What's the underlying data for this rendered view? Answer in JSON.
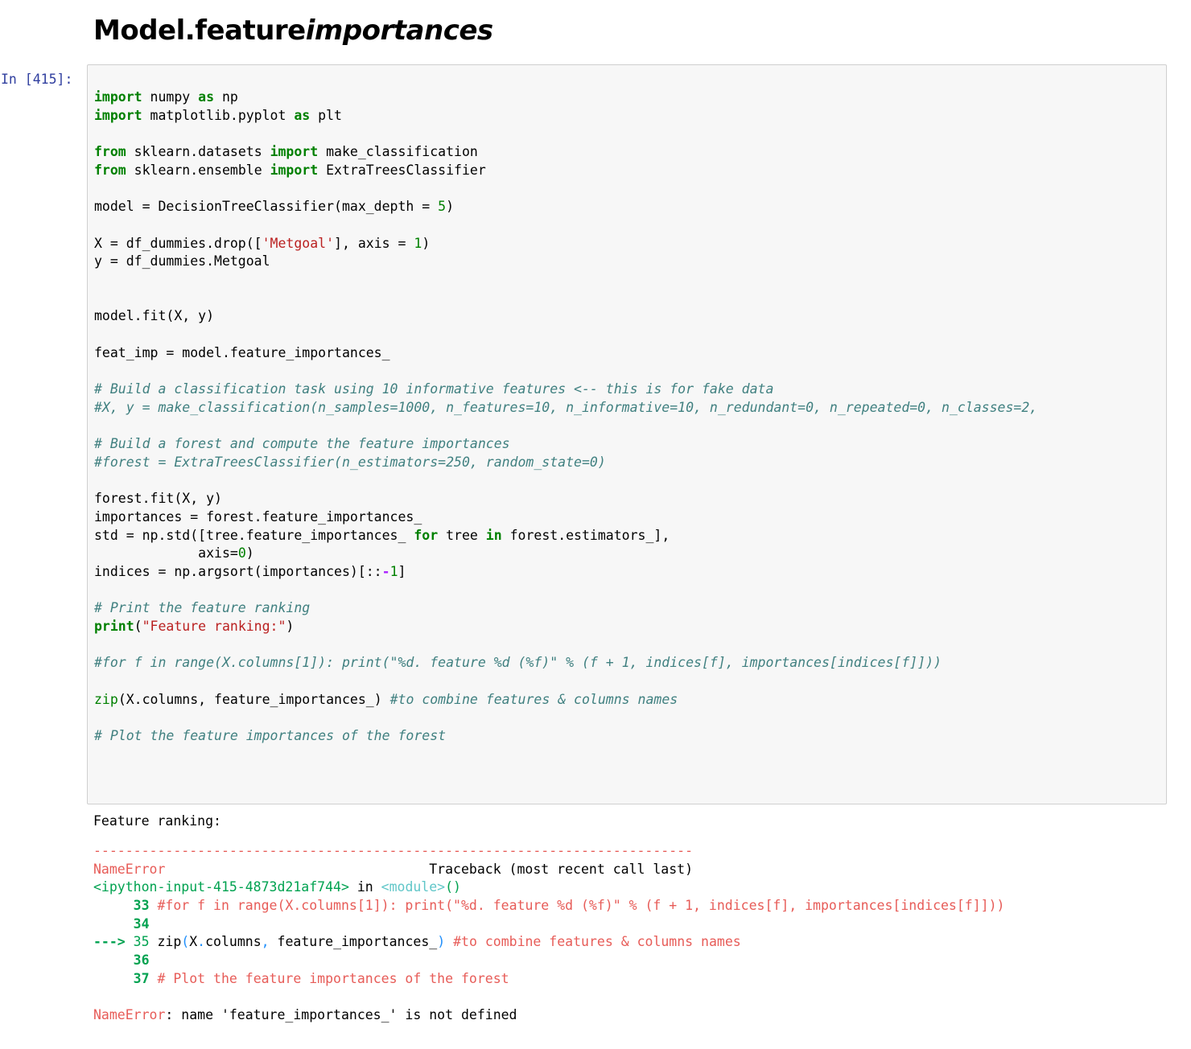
{
  "heading": {
    "prefix": "Model.feature",
    "italic": "importances"
  },
  "cell": {
    "prompt": "In [415]:",
    "code_lines": [
      [
        [
          "kw",
          "import"
        ],
        [
          "t",
          " numpy "
        ],
        [
          "kw",
          "as"
        ],
        [
          "t",
          " np"
        ]
      ],
      [
        [
          "kw",
          "import"
        ],
        [
          "t",
          " matplotlib.pyplot "
        ],
        [
          "kw",
          "as"
        ],
        [
          "t",
          " plt"
        ]
      ],
      [],
      [
        [
          "kw",
          "from"
        ],
        [
          "t",
          " sklearn.datasets "
        ],
        [
          "kw",
          "import"
        ],
        [
          "t",
          " make_classification"
        ]
      ],
      [
        [
          "kw",
          "from"
        ],
        [
          "t",
          " sklearn.ensemble "
        ],
        [
          "kw",
          "import"
        ],
        [
          "t",
          " ExtraTreesClassifier"
        ]
      ],
      [],
      [
        [
          "t",
          "model = DecisionTreeClassifier(max_depth = "
        ],
        [
          "num",
          "5"
        ],
        [
          "t",
          ")"
        ]
      ],
      [],
      [
        [
          "t",
          "X = df_dummies.drop(["
        ],
        [
          "str",
          "'Metgoal'"
        ],
        [
          "t",
          "], axis = "
        ],
        [
          "num",
          "1"
        ],
        [
          "t",
          ")"
        ]
      ],
      [
        [
          "t",
          "y = df_dummies.Metgoal"
        ]
      ],
      [],
      [],
      [
        [
          "t",
          "model.fit(X, y)"
        ]
      ],
      [],
      [
        [
          "t",
          "feat_imp = model.feature_importances_"
        ]
      ],
      [],
      [
        [
          "cm",
          "# Build a classification task using 10 informative features <-- this is for fake data"
        ]
      ],
      [
        [
          "cm",
          "#X, y = make_classification(n_samples=1000, n_features=10, n_informative=10, n_redundant=0, n_repeated=0, n_classes=2,"
        ]
      ],
      [],
      [
        [
          "cm",
          "# Build a forest and compute the feature importances"
        ]
      ],
      [
        [
          "cm",
          "#forest = ExtraTreesClassifier(n_estimators=250, random_state=0)"
        ]
      ],
      [],
      [
        [
          "t",
          "forest.fit(X, y)"
        ]
      ],
      [
        [
          "t",
          "importances = forest.feature_importances_"
        ]
      ],
      [
        [
          "t",
          "std = np.std([tree.feature_importances_ "
        ],
        [
          "kw",
          "for"
        ],
        [
          "t",
          " tree "
        ],
        [
          "kw",
          "in"
        ],
        [
          "t",
          " forest.estimators_],"
        ]
      ],
      [
        [
          "t",
          "             axis="
        ],
        [
          "num",
          "0"
        ],
        [
          "t",
          ")"
        ]
      ],
      [
        [
          "t",
          "indices = np.argsort(importances)[::"
        ],
        [
          "op",
          "-"
        ],
        [
          "num",
          "1"
        ],
        [
          "t",
          "]"
        ]
      ],
      [],
      [
        [
          "cm",
          "# Print the feature ranking"
        ]
      ],
      [
        [
          "kw",
          "print"
        ],
        [
          "t",
          "("
        ],
        [
          "str",
          "\"Feature ranking:\""
        ],
        [
          "t",
          ")"
        ]
      ],
      [],
      [
        [
          "cm",
          "#for f in range(X.columns[1]): print(\"%d. feature %d (%f)\" % (f + 1, indices[f], importances[indices[f]]))"
        ]
      ],
      [],
      [
        [
          "bi",
          "zip"
        ],
        [
          "t",
          "(X.columns, feature_importances_) "
        ],
        [
          "cm",
          "#to combine features & columns names"
        ]
      ],
      [],
      [
        [
          "cm",
          "# Plot the feature importances of the forest"
        ]
      ]
    ]
  },
  "output": {
    "stream": "Feature ranking:",
    "error_lines": [
      [
        [
          "er",
          "---------------------------------------------------------------------------"
        ]
      ],
      [
        [
          "er",
          "NameError"
        ],
        [
          "t",
          "                                 Traceback (most recent call last)"
        ]
      ],
      [
        [
          "eg",
          "<ipython-input-415-4873d21af744>"
        ],
        [
          "t",
          " in "
        ],
        [
          "ecy",
          "<module>"
        ],
        [
          "eg",
          "()"
        ]
      ],
      [
        [
          "t",
          "     "
        ],
        [
          "egb",
          "33"
        ],
        [
          "t",
          " "
        ],
        [
          "er",
          "#for f in range(X.columns[1]): print(\"%d. feature %d (%f)\" % (f + 1, indices[f], importances[indices[f]]))"
        ]
      ],
      [
        [
          "t",
          "     "
        ],
        [
          "egb",
          "34"
        ]
      ],
      [
        [
          "dg",
          "---> "
        ],
        [
          "eg",
          "35"
        ],
        [
          "t",
          " zip"
        ],
        [
          "lineno",
          "("
        ],
        [
          "t",
          "X"
        ],
        [
          "lineno",
          "."
        ],
        [
          "t",
          "columns"
        ],
        [
          "lineno",
          ","
        ],
        [
          "t",
          " feature_importances_"
        ],
        [
          "lineno",
          ")"
        ],
        [
          "t",
          " "
        ],
        [
          "er",
          "#to combine features & columns names"
        ]
      ],
      [
        [
          "t",
          "     "
        ],
        [
          "egb",
          "36"
        ]
      ],
      [
        [
          "t",
          "     "
        ],
        [
          "egb",
          "37"
        ],
        [
          "t",
          " "
        ],
        [
          "er",
          "# Plot the feature importances of the forest"
        ]
      ],
      [],
      [
        [
          "er",
          "NameError"
        ],
        [
          "t",
          ": name 'feature_importances_' is not defined"
        ]
      ]
    ]
  },
  "colors": {
    "keyword": "#008000",
    "string": "#ba2121",
    "comment": "#408080",
    "prompt": "#303f9f",
    "error_red": "#e75c58",
    "error_green": "#00a250",
    "cell_background": "#f7f7f7",
    "cell_border": "#cfcfcf"
  }
}
